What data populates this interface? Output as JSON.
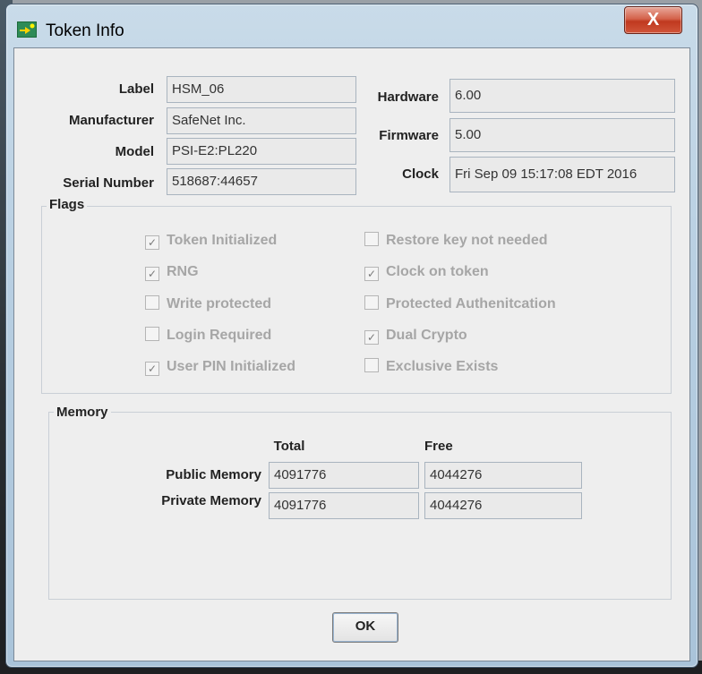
{
  "window": {
    "title": "Token Info",
    "close_label": "X"
  },
  "info": {
    "label": {
      "name": "Label",
      "value": "HSM_06"
    },
    "manufacturer": {
      "name": "Manufacturer",
      "value": "SafeNet Inc."
    },
    "model": {
      "name": "Model",
      "value": "PSI-E2:PL220"
    },
    "serial": {
      "name": "Serial Number",
      "value": "518687:44657"
    },
    "hardware": {
      "name": "Hardware",
      "value": "6.00"
    },
    "firmware": {
      "name": "Firmware",
      "value": "5.00"
    },
    "clock": {
      "name": "Clock",
      "value": "Fri Sep 09 15:17:08 EDT 2016"
    }
  },
  "flags": {
    "title": "Flags",
    "items": [
      {
        "label": "Token Initialized",
        "checked": true
      },
      {
        "label": "RNG",
        "checked": true
      },
      {
        "label": "Write protected",
        "checked": false
      },
      {
        "label": "Login Required",
        "checked": false
      },
      {
        "label": "User PIN Initialized",
        "checked": true
      },
      {
        "label": "Restore key not needed",
        "checked": false
      },
      {
        "label": "Clock on token",
        "checked": true
      },
      {
        "label": "Protected Authenitcation",
        "checked": false
      },
      {
        "label": "Dual Crypto",
        "checked": true
      },
      {
        "label": "Exclusive Exists",
        "checked": false
      }
    ]
  },
  "memory": {
    "title": "Memory",
    "col_total": "Total",
    "col_free": "Free",
    "public": {
      "label": "Public Memory",
      "total": "4091776",
      "free": "4044276"
    },
    "private": {
      "label": "Private Memory",
      "total": "4091776",
      "free": "4044276"
    }
  },
  "ok_label": "OK",
  "colors": {
    "close_button": "#c9462c",
    "check_mark": "#7a7a7a"
  }
}
